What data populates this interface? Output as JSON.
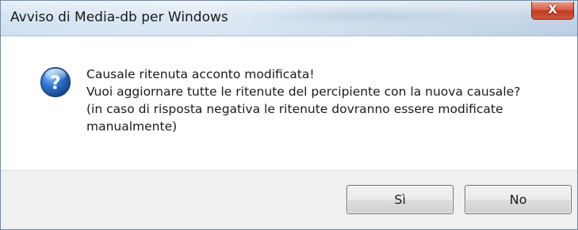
{
  "window": {
    "title": "Avviso di Media-db per Windows",
    "close_glyph": "X",
    "close_button_color": "#c9452a"
  },
  "message": {
    "icon": "question-icon",
    "icon_color": "#1e5fb5",
    "lines": [
      "Causale ritenuta acconto modificata!",
      "Vuoi aggiornare tutte le ritenute del percipiente con la nuova causale?",
      "(in caso di risposta negativa le ritenute dovranno essere modificate",
      "manualmente)"
    ]
  },
  "buttons": {
    "yes_label": "Sì",
    "no_label": "No"
  }
}
